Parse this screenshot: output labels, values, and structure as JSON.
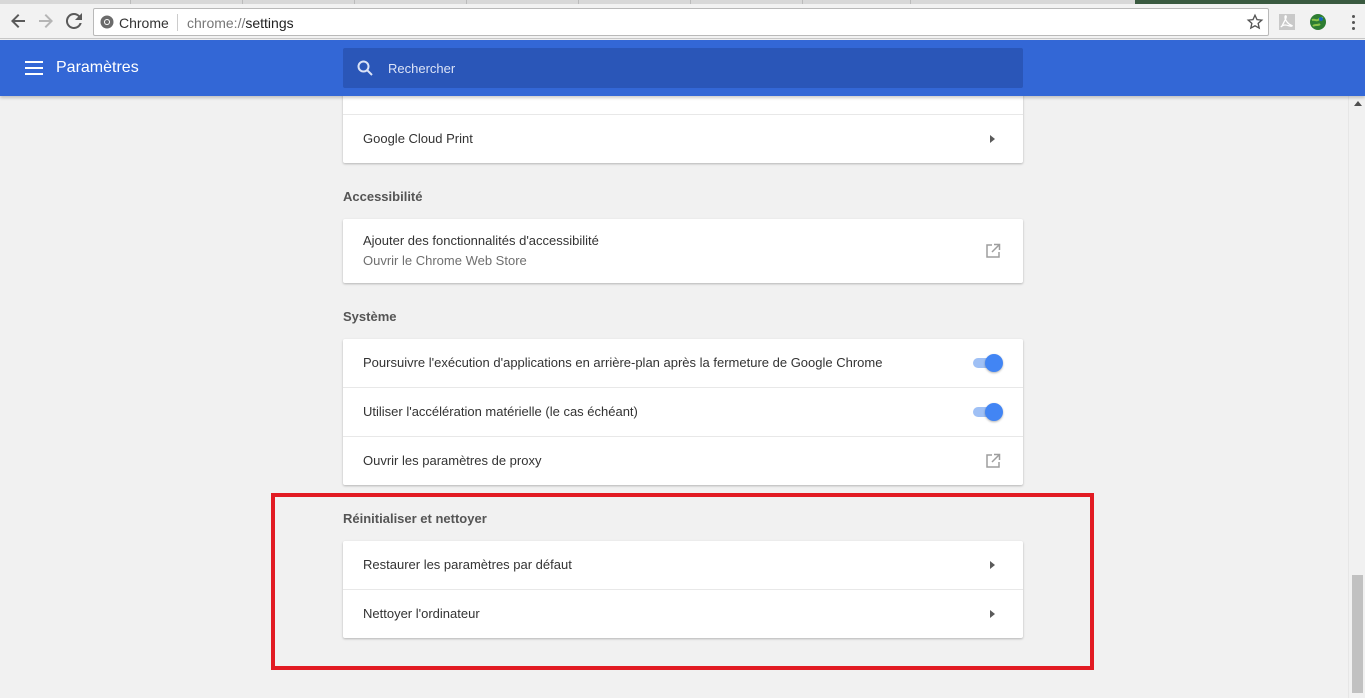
{
  "browser": {
    "site_label": "Chrome",
    "url_scheme": "chrome://",
    "url_path": "settings"
  },
  "header": {
    "title": "Paramètres",
    "search_placeholder": "Rechercher"
  },
  "sections": {
    "printing": {
      "cloud_print": "Google Cloud Print"
    },
    "accessibility": {
      "title": "Accessibilité",
      "add_features": "Ajouter des fonctionnalités d'accessibilité",
      "add_features_sub": "Ouvrir le Chrome Web Store"
    },
    "system": {
      "title": "Système",
      "background_apps": "Poursuivre l'exécution d'applications en arrière-plan après la fermeture de Google Chrome",
      "background_apps_on": true,
      "hardware_accel": "Utiliser l'accélération matérielle (le cas échéant)",
      "hardware_accel_on": true,
      "proxy": "Ouvrir les paramètres de proxy"
    },
    "reset": {
      "title": "Réinitialiser et nettoyer",
      "restore_defaults": "Restaurer les paramètres par défaut",
      "cleanup": "Nettoyer l'ordinateur"
    }
  },
  "colors": {
    "header_blue": "#3367d6",
    "toggle_on": "#4285f4",
    "highlight_red": "#e21b23"
  }
}
